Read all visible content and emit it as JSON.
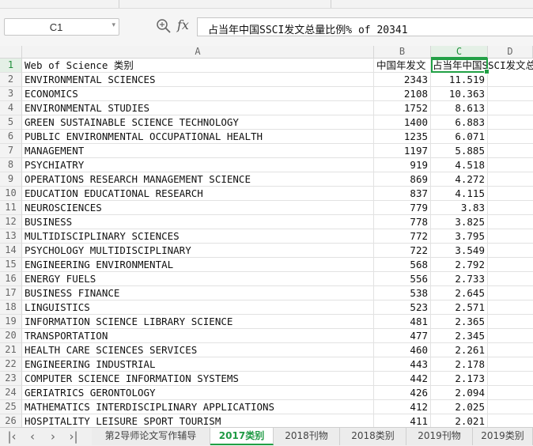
{
  "name_box": "C1",
  "formula_bar": {
    "fx_label": "fx",
    "content": "占当年中国SSCI发文总量比例% of 20341"
  },
  "columns": [
    "A",
    "B",
    "C",
    "D"
  ],
  "headers": {
    "a": "Web of Science 类别",
    "b": "中国年发文",
    "c": "占当年中国SSCI发文总量比例% of 20341"
  },
  "rows": [
    {
      "n": "2",
      "a": "ENVIRONMENTAL SCIENCES",
      "b": "2343",
      "c": "11.519"
    },
    {
      "n": "3",
      "a": "ECONOMICS",
      "b": "2108",
      "c": "10.363"
    },
    {
      "n": "4",
      "a": "ENVIRONMENTAL STUDIES",
      "b": "1752",
      "c": "8.613"
    },
    {
      "n": "5",
      "a": "GREEN SUSTAINABLE SCIENCE TECHNOLOGY",
      "b": "1400",
      "c": "6.883"
    },
    {
      "n": "6",
      "a": "PUBLIC ENVIRONMENTAL OCCUPATIONAL HEALTH",
      "b": "1235",
      "c": "6.071"
    },
    {
      "n": "7",
      "a": "MANAGEMENT",
      "b": "1197",
      "c": "5.885"
    },
    {
      "n": "8",
      "a": "PSYCHIATRY",
      "b": "919",
      "c": "4.518"
    },
    {
      "n": "9",
      "a": "OPERATIONS RESEARCH MANAGEMENT SCIENCE",
      "b": "869",
      "c": "4.272"
    },
    {
      "n": "10",
      "a": "EDUCATION EDUCATIONAL RESEARCH",
      "b": "837",
      "c": "4.115"
    },
    {
      "n": "11",
      "a": "NEUROSCIENCES",
      "b": "779",
      "c": "3.83"
    },
    {
      "n": "12",
      "a": "BUSINESS",
      "b": "778",
      "c": "3.825"
    },
    {
      "n": "13",
      "a": "MULTIDISCIPLINARY SCIENCES",
      "b": "772",
      "c": "3.795"
    },
    {
      "n": "14",
      "a": "PSYCHOLOGY MULTIDISCIPLINARY",
      "b": "722",
      "c": "3.549"
    },
    {
      "n": "15",
      "a": "ENGINEERING ENVIRONMENTAL",
      "b": "568",
      "c": "2.792"
    },
    {
      "n": "16",
      "a": "ENERGY FUELS",
      "b": "556",
      "c": "2.733"
    },
    {
      "n": "17",
      "a": "BUSINESS FINANCE",
      "b": "538",
      "c": "2.645"
    },
    {
      "n": "18",
      "a": "LINGUISTICS",
      "b": "523",
      "c": "2.571"
    },
    {
      "n": "19",
      "a": "INFORMATION SCIENCE LIBRARY SCIENCE",
      "b": "481",
      "c": "2.365"
    },
    {
      "n": "20",
      "a": "TRANSPORTATION",
      "b": "477",
      "c": "2.345"
    },
    {
      "n": "21",
      "a": "HEALTH CARE SCIENCES SERVICES",
      "b": "460",
      "c": "2.261"
    },
    {
      "n": "22",
      "a": "ENGINEERING INDUSTRIAL",
      "b": "443",
      "c": "2.178"
    },
    {
      "n": "23",
      "a": "COMPUTER SCIENCE INFORMATION SYSTEMS",
      "b": "442",
      "c": "2.173"
    },
    {
      "n": "24",
      "a": "GERIATRICS GERONTOLOGY",
      "b": "426",
      "c": "2.094"
    },
    {
      "n": "25",
      "a": "MATHEMATICS INTERDISCIPLINARY APPLICATIONS",
      "b": "412",
      "c": "2.025"
    },
    {
      "n": "26",
      "a": "HOSPITALITY LEISURE SPORT TOURISM",
      "b": "411",
      "c": "2.021"
    }
  ],
  "sheet_tabs": [
    "第2导师论文写作辅导",
    "2017类别",
    "2018刊物",
    "2018类别",
    "2019刊物",
    "2019类别"
  ],
  "active_tab": "2017类别",
  "accent_color": "#21a045"
}
